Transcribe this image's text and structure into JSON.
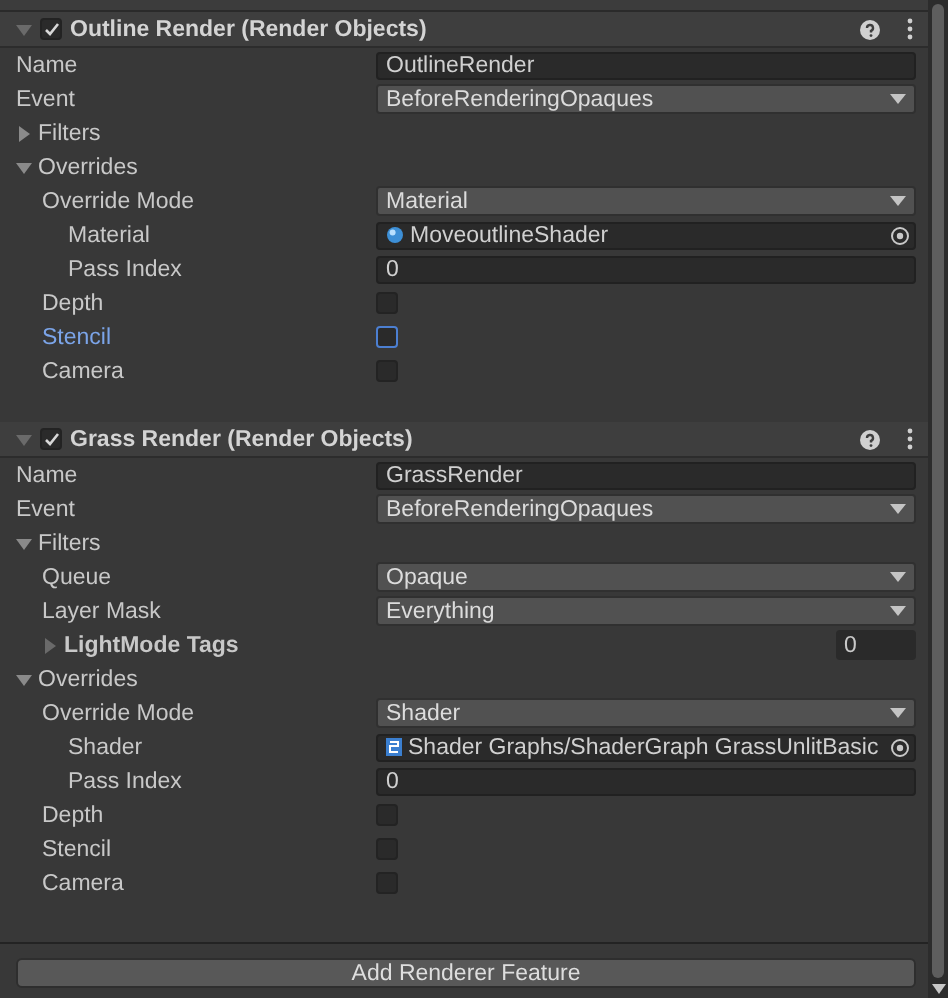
{
  "features": [
    {
      "title": "Outline Render (Render Objects)",
      "enabled": true,
      "expanded": true,
      "rows": [
        {
          "kind": "text",
          "label": "Name",
          "value": "OutlineRender"
        },
        {
          "kind": "dropdown",
          "label": "Event",
          "value": "BeforeRenderingOpaques"
        },
        {
          "kind": "foldout",
          "label": "Filters",
          "expanded": false
        },
        {
          "kind": "foldout",
          "label": "Overrides",
          "expanded": true,
          "children": [
            {
              "kind": "dropdown",
              "label": "Override Mode",
              "value": "Material",
              "children": [
                {
                  "kind": "material_object",
                  "label": "Material",
                  "value": "MoveoutlineShader"
                },
                {
                  "kind": "text",
                  "label": "Pass Index",
                  "value": "0"
                }
              ]
            },
            {
              "kind": "checkbox",
              "label": "Depth",
              "checked": false,
              "focused": false
            },
            {
              "kind": "checkbox",
              "label": "Stencil",
              "checked": false,
              "focused": true
            },
            {
              "kind": "checkbox",
              "label": "Camera",
              "checked": false,
              "focused": false
            }
          ]
        }
      ]
    },
    {
      "title": "Grass Render (Render Objects)",
      "enabled": true,
      "expanded": true,
      "rows": [
        {
          "kind": "text",
          "label": "Name",
          "value": "GrassRender"
        },
        {
          "kind": "dropdown",
          "label": "Event",
          "value": "BeforeRenderingOpaques"
        },
        {
          "kind": "foldout",
          "label": "Filters",
          "expanded": true,
          "children": [
            {
              "kind": "dropdown",
              "label": "Queue",
              "value": "Opaque"
            },
            {
              "kind": "dropdown",
              "label": "Layer Mask",
              "value": "Everything"
            },
            {
              "kind": "array",
              "label": "LightMode Tags",
              "expanded": false,
              "count": "0"
            }
          ]
        },
        {
          "kind": "foldout",
          "label": "Overrides",
          "expanded": true,
          "children": [
            {
              "kind": "dropdown",
              "label": "Override Mode",
              "value": "Shader",
              "children": [
                {
                  "kind": "shader_object",
                  "label": "Shader",
                  "value": "Shader Graphs/ShaderGraph GrassUnlitBasic"
                },
                {
                  "kind": "text",
                  "label": "Pass Index",
                  "value": "0"
                }
              ]
            },
            {
              "kind": "checkbox",
              "label": "Depth",
              "checked": false,
              "focused": false
            },
            {
              "kind": "checkbox",
              "label": "Stencil",
              "checked": false,
              "focused": false
            },
            {
              "kind": "checkbox",
              "label": "Camera",
              "checked": false,
              "focused": false
            }
          ]
        }
      ]
    }
  ],
  "add_button": "Add Renderer Feature"
}
